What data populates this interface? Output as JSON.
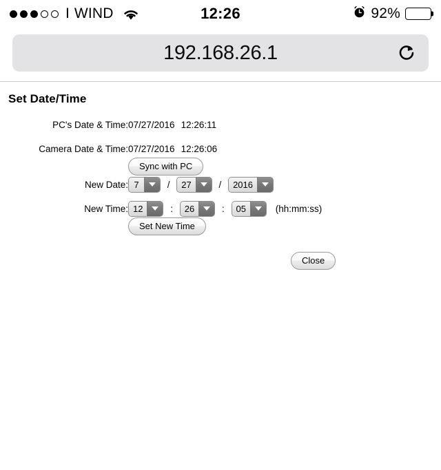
{
  "status_bar": {
    "signal_dots_filled": 3,
    "signal_dots_total": 5,
    "carrier_separator": "I",
    "carrier": "WIND",
    "wifi_icon": "wifi-icon",
    "time": "12:26",
    "alarm_icon": "alarm-clock-icon",
    "battery_percent": "92%",
    "battery_level": 92
  },
  "browser": {
    "url": "192.168.26.1",
    "reload_icon": "reload-icon"
  },
  "page": {
    "title": "Set Date/Time",
    "rows": {
      "pc_label": "PC's Date & Time:",
      "pc_date": "07/27/2016",
      "pc_time": "12:26:11",
      "camera_label": "Camera Date & Time:",
      "camera_date": "07/27/2016",
      "camera_time": "12:26:06",
      "new_date_label": "New Date:",
      "new_time_label": "New Time:"
    },
    "buttons": {
      "sync": "Sync with PC",
      "set_new_time": "Set New Time",
      "close": "Close"
    },
    "date_selects": {
      "month": "7",
      "day": "27",
      "year": "2016",
      "separator": "/"
    },
    "time_selects": {
      "hour": "12",
      "minute": "26",
      "second": "05",
      "separator": ":"
    },
    "time_format_hint": "(hh:mm:ss)"
  },
  "colors": {
    "url_bar_bg": "#e3e3e5",
    "page_bg": "#ffffff",
    "text": "#000000",
    "select_arrow_bg": "#777777",
    "chrome_divider": "#c8c8c8"
  }
}
